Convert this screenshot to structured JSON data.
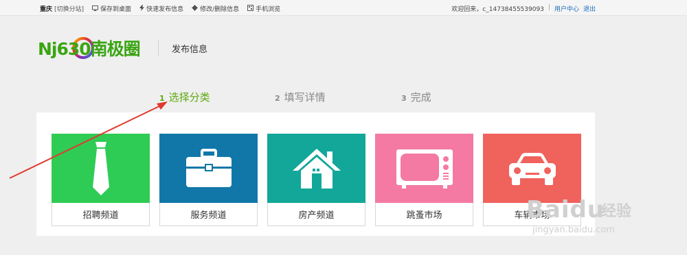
{
  "topbar": {
    "city": "重庆",
    "switch_city": "[切换分站]",
    "items": [
      {
        "label": "保存到桌面",
        "icon": "monitor-icon"
      },
      {
        "label": "快速发布信息",
        "icon": "lightning-icon"
      },
      {
        "label": "修改/删除信息",
        "icon": "gear-icon"
      },
      {
        "label": "手机浏览",
        "icon": "qr-code-icon"
      }
    ],
    "welcome": "欢迎回来，c_14738455539093",
    "separator": "|",
    "user_center": "用户中心",
    "logout": "退出"
  },
  "header": {
    "logo_text": "Nj630南极圈",
    "page_title": "发布信息"
  },
  "steps": [
    {
      "num": "1",
      "label": "选择分类",
      "active": true
    },
    {
      "num": "2",
      "label": "填写详情",
      "active": false
    },
    {
      "num": "3",
      "label": "完成",
      "active": false
    }
  ],
  "categories": [
    {
      "label": "招聘频道",
      "color": "#2ecc55",
      "icon": "tie-icon"
    },
    {
      "label": "服务频道",
      "color": "#1177a8",
      "icon": "briefcase-icon"
    },
    {
      "label": "房产频道",
      "color": "#12a799",
      "icon": "house-icon"
    },
    {
      "label": "跳蚤市场",
      "color": "#f47aa3",
      "icon": "tv-icon"
    },
    {
      "label": "车辆市场",
      "color": "#f0625c",
      "icon": "car-icon"
    }
  ],
  "watermark": {
    "brand": "Baidu",
    "cn": "经验",
    "url": "jingyan.baidu.com"
  },
  "colors": {
    "accent_green": "#5ea80e",
    "annotation_red": "#e03a2e",
    "link_blue": "#1b6bb8"
  }
}
